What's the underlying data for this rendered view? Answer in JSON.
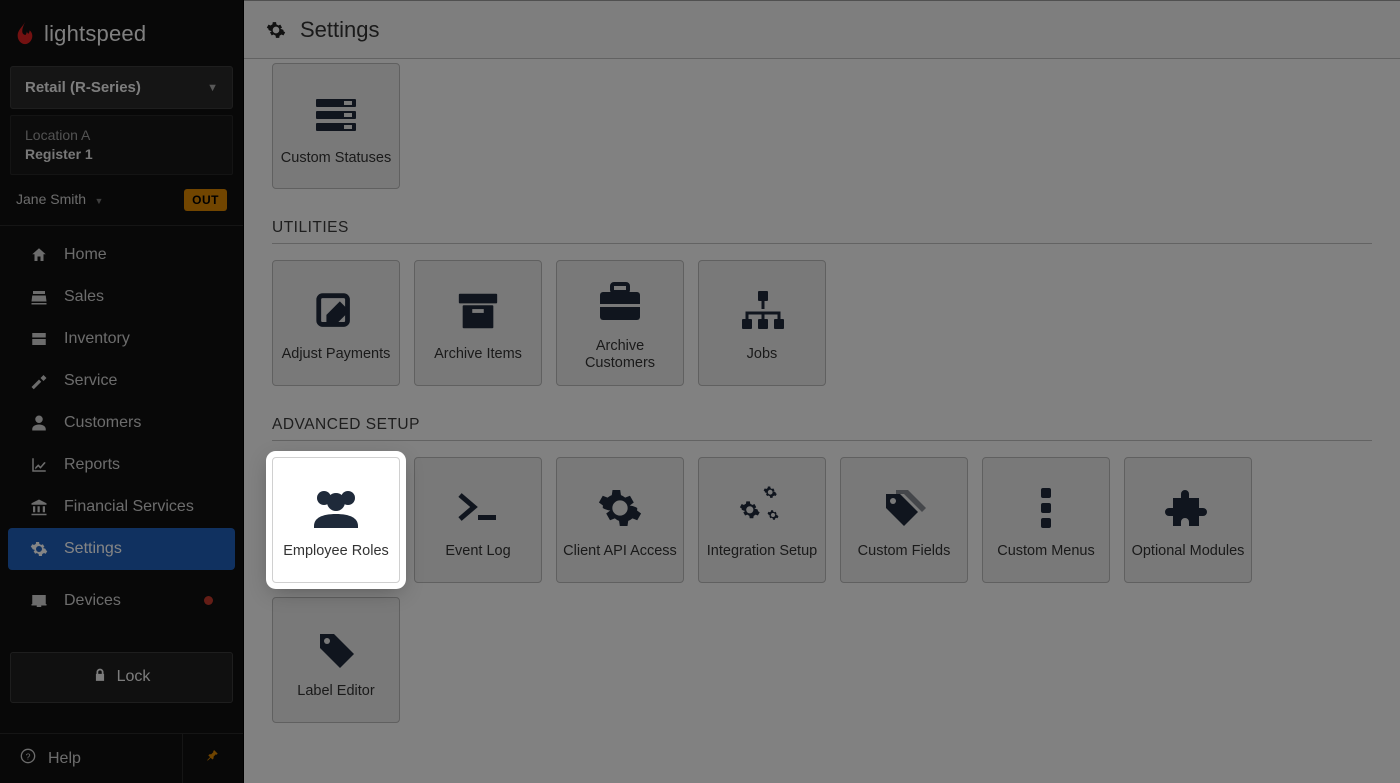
{
  "brand": "lightspeed",
  "sidebar": {
    "shop_selector": "Retail (R-Series)",
    "location_line1": "Location A",
    "location_line2": "Register 1",
    "user_name": "Jane Smith",
    "status_badge": "OUT",
    "nav": [
      {
        "label": "Home"
      },
      {
        "label": "Sales"
      },
      {
        "label": "Inventory"
      },
      {
        "label": "Service"
      },
      {
        "label": "Customers"
      },
      {
        "label": "Reports"
      },
      {
        "label": "Financial Services"
      },
      {
        "label": "Settings"
      },
      {
        "label": "Devices"
      }
    ],
    "lock_label": "Lock",
    "help_label": "Help"
  },
  "page_title": "Settings",
  "sections": {
    "pre": {
      "cards": [
        {
          "label": "Custom Statuses"
        }
      ]
    },
    "utilities": {
      "title": "UTILITIES",
      "cards": [
        {
          "label": "Adjust Payments"
        },
        {
          "label": "Archive Items"
        },
        {
          "label": "Archive Customers"
        },
        {
          "label": "Jobs"
        }
      ]
    },
    "advanced": {
      "title": "ADVANCED SETUP",
      "cards": [
        {
          "label": "Employee Roles"
        },
        {
          "label": "Event Log"
        },
        {
          "label": "Client API Access"
        },
        {
          "label": "Integration Setup"
        },
        {
          "label": "Custom Fields"
        },
        {
          "label": "Custom Menus"
        },
        {
          "label": "Optional Modules"
        },
        {
          "label": "Label Editor"
        }
      ]
    }
  }
}
